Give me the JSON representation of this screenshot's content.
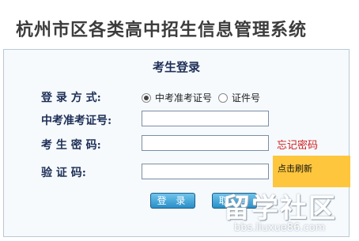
{
  "page": {
    "title": "杭州市区各类高中招生信息管理系统"
  },
  "login": {
    "title": "考生登录",
    "method_label": "登 录 方 式:",
    "method_options": [
      "中考准考证号",
      "证件号"
    ],
    "method_selected": "中考准考证号",
    "exam_id_label": "中考准考证号:",
    "exam_id_value": "",
    "password_label": "考 生 密 码:",
    "password_value": "",
    "forgot_password": "忘记密码",
    "captcha_label": "验 证 码:",
    "captcha_value": "",
    "captcha_refresh": "点击刷新",
    "login_button": "登 录",
    "cancel_button": "取 消"
  },
  "watermark": {
    "main": "留学社区",
    "sub": "bbs.liuxue86.com"
  },
  "colors": {
    "label": "#1e2f57",
    "link": "#d02020",
    "captcha_bg": "#fdc63d",
    "button": "#2a8ec8",
    "panel_border": "#b9c9d6"
  }
}
